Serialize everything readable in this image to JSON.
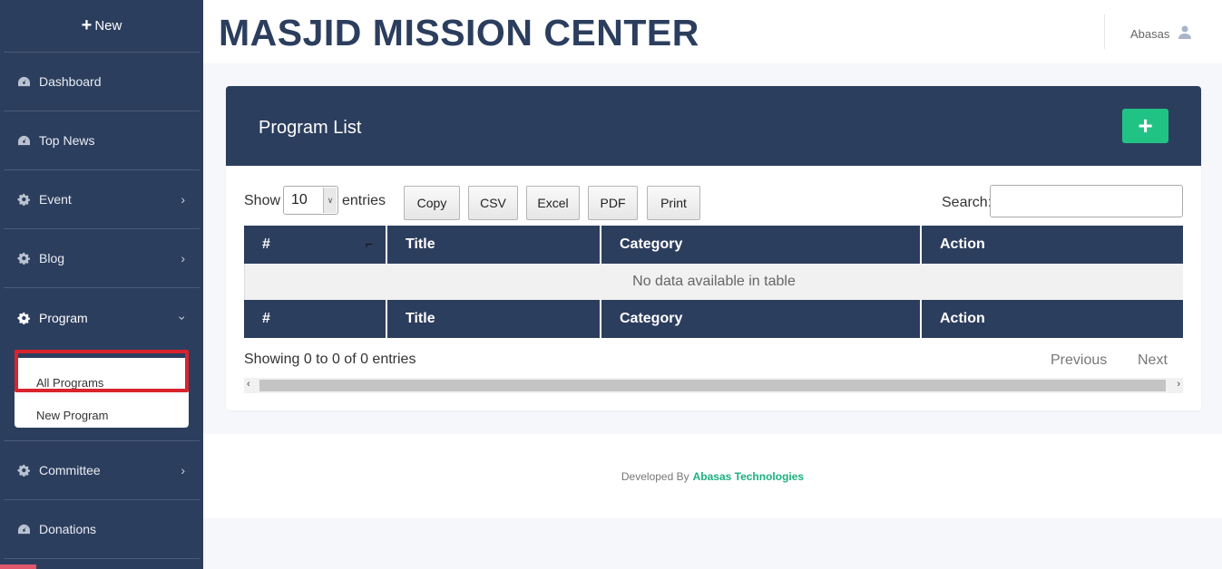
{
  "sidebar": {
    "new_label": "New",
    "items": [
      {
        "label": "Dashboard",
        "icon": "gauge-icon"
      },
      {
        "label": "Top News",
        "icon": "gauge-icon"
      },
      {
        "label": "Event",
        "icon": "gear-icon"
      },
      {
        "label": "Blog",
        "icon": "gear-icon"
      },
      {
        "label": "Program",
        "icon": "gear-icon"
      },
      {
        "label": "Committee",
        "icon": "gear-icon"
      },
      {
        "label": "Donations",
        "icon": "gauge-icon"
      }
    ],
    "program_submenu": [
      "All Programs",
      "New Program"
    ]
  },
  "header": {
    "brand": "MASJID MISSION CENTER",
    "user_name": "Abasas"
  },
  "card": {
    "title": "Program List",
    "length": {
      "show": "Show",
      "value": "10",
      "entries": "entries"
    },
    "buttons": [
      "Copy",
      "CSV",
      "Excel",
      "PDF",
      "Print"
    ],
    "search_label": "Search:",
    "columns": [
      "#",
      "Title",
      "Category",
      "Action"
    ],
    "empty_text": "No data available in table",
    "info": "Showing 0 to 0 of 0 entries",
    "previous": "Previous",
    "next": "Next"
  },
  "footer": {
    "prefix": "Developed By",
    "company": "Abasas Technologies"
  },
  "colors": {
    "navy": "#2c3e5e",
    "green": "#21c385",
    "highlight_red": "#d9232d"
  }
}
